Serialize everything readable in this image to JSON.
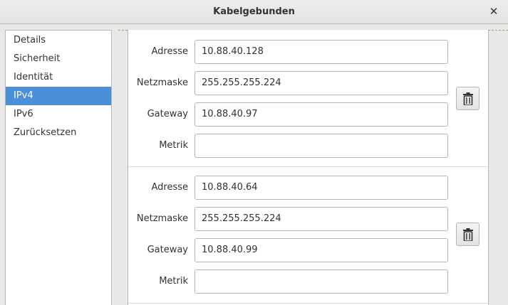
{
  "window": {
    "title": "Kabelgebunden",
    "close_icon": "close-icon"
  },
  "sidebar": {
    "items": [
      {
        "label": "Details",
        "active": false
      },
      {
        "label": "Sicherheit",
        "active": false
      },
      {
        "label": "Identität",
        "active": false
      },
      {
        "label": "IPv4",
        "active": true
      },
      {
        "label": "IPv6",
        "active": false
      },
      {
        "label": "Zurücksetzen",
        "active": false
      }
    ],
    "accent_color": "#4a90d9"
  },
  "routes": [
    {
      "address_label": "Adresse",
      "address": "10.88.40.128",
      "netmask_label": "Netzmaske",
      "netmask": "255.255.255.224",
      "gateway_label": "Gateway",
      "gateway": "10.88.40.97",
      "metric_label": "Metrik",
      "metric": "",
      "delete_icon": "trash-icon"
    },
    {
      "address_label": "Adresse",
      "address": "10.88.40.64",
      "netmask_label": "Netzmaske",
      "netmask": "255.255.255.224",
      "gateway_label": "Gateway",
      "gateway": "10.88.40.99",
      "metric_label": "Metrik",
      "metric": "",
      "delete_icon": "trash-icon"
    }
  ]
}
